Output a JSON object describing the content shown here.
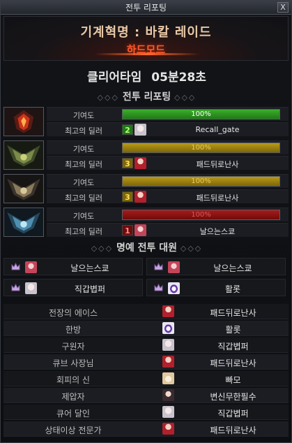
{
  "window": {
    "title": "전투 리포팅",
    "close_label": "X"
  },
  "header": {
    "raid_name": "기계혁명 : 바칼 레이드",
    "mode": "하드모드"
  },
  "clear_time": {
    "label": "클리어타임",
    "value": "05분28초"
  },
  "report_section": {
    "title": "전투 리포팅"
  },
  "contribution_label": "기여도",
  "top_dealer_label": "최고의 딜러",
  "players": [
    {
      "portrait": "red-flame-emblem-icon",
      "contribution_pct": "100%",
      "contribution_value": 100,
      "bar_color": "#2e9a22",
      "dealer_rank": "2",
      "dealer_avatar": "white-hair-avatar",
      "dealer_name": "Recall_gate"
    },
    {
      "portrait": "green-wing-emblem-icon",
      "contribution_pct": "100%",
      "contribution_value": 100,
      "bar_color": "#a88a12",
      "dealer_rank": "3",
      "dealer_avatar": "red-hood-avatar",
      "dealer_name": "패드뒤로난사"
    },
    {
      "portrait": "dark-wing-emblem-icon",
      "contribution_pct": "100%",
      "contribution_value": 100,
      "bar_color": "#a88a12",
      "dealer_rank": "3",
      "dealer_avatar": "red-hood-avatar",
      "dealer_name": "패드뒤로난사"
    },
    {
      "portrait": "ice-wing-emblem-icon",
      "contribution_pct": "100%",
      "contribution_value": 100,
      "bar_color": "#9a1717",
      "dealer_rank": "1",
      "dealer_avatar": "pink-hair-avatar",
      "dealer_name": "날으는스쿄"
    }
  ],
  "honor_section": {
    "title": "명예 전투 대원",
    "members": [
      {
        "avatar": "pink-hair-avatar",
        "name": "날으는스쿄"
      },
      {
        "avatar": "pink-hair-avatar",
        "name": "날으는스쿄"
      },
      {
        "avatar": "white-hair-avatar",
        "name": "직갑볍퍼"
      },
      {
        "avatar": "purple-mask-avatar",
        "name": "활롯"
      }
    ]
  },
  "awards": [
    {
      "title": "전장의 에이스",
      "avatar": "red-hood-avatar",
      "player": "패드뒤로난사"
    },
    {
      "title": "한방",
      "avatar": "purple-mask-avatar",
      "player": "활롯"
    },
    {
      "title": "구원자",
      "avatar": "white-hair-avatar",
      "player": "직갑볍퍼"
    },
    {
      "title": "큐브 사장님",
      "avatar": "red-hood-avatar",
      "player": "패드뒤로난사"
    },
    {
      "title": "회피의 신",
      "avatar": "bunny-avatar",
      "player": "빠모"
    },
    {
      "title": "제압자",
      "avatar": "dark-hair-avatar",
      "player": "변신무한필수"
    },
    {
      "title": "큐어 달인",
      "avatar": "white-hair-avatar",
      "player": "직갑볍퍼"
    },
    {
      "title": "상태이상 전문가",
      "avatar": "red-hood-avatar",
      "player": "패드뒤로난사"
    }
  ]
}
